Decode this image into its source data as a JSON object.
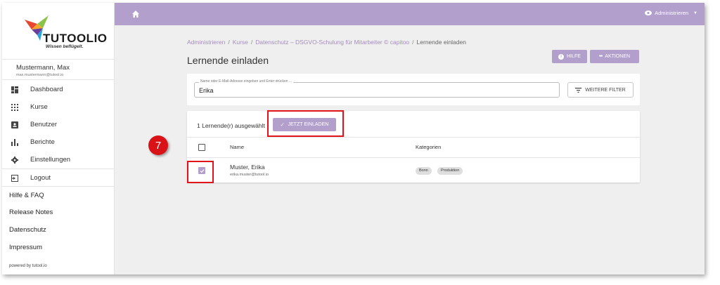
{
  "brand": {
    "name": "TUTOOLIO",
    "tagline": "Wissen beflügelt."
  },
  "user": {
    "name": "Mustermann, Max",
    "email": "max.mustermann@tutool.io"
  },
  "nav": [
    {
      "label": "Dashboard",
      "icon": "dashboard-icon"
    },
    {
      "label": "Kurse",
      "icon": "grid-icon"
    },
    {
      "label": "Benutzer",
      "icon": "user-card-icon"
    },
    {
      "label": "Berichte",
      "icon": "bar-chart-icon"
    },
    {
      "label": "Einstellungen",
      "icon": "gear-icon"
    },
    {
      "label": "Logout",
      "icon": "logout-icon"
    }
  ],
  "links": [
    "Hilfe & FAQ",
    "Release Notes",
    "Datenschutz",
    "Impressum"
  ],
  "powered": "powered by tutool.io",
  "topbar": {
    "admin_label": "Administrieren"
  },
  "breadcrumb": {
    "items": [
      "Administrieren",
      "Kurse",
      "Datenschutz – DSGVO-Schulung für Mitarbeiter © capitoo"
    ],
    "current": "Lernende einladen"
  },
  "page": {
    "title": "Lernende einladen"
  },
  "actions": {
    "help": "HILFE",
    "more": "AKTIONEN"
  },
  "search": {
    "label": "Name oder E-Mail-Adresse eingeben und Enter drücken ...",
    "value": "Erika",
    "filter_button": "WEITERE FILTER"
  },
  "table": {
    "selected_text": "1 Lernende(r) ausgewählt",
    "invite_button": "JETZT EINLADEN",
    "columns": [
      "Name",
      "Kategorien"
    ],
    "rows": [
      {
        "name": "Muster, Erika",
        "email": "erika.muster@tutool.io",
        "categories": [
          "Bonn",
          "Produktion"
        ],
        "checked": true
      }
    ]
  },
  "step": "7",
  "colors": {
    "accent": "#b39fcc",
    "highlight": "#e0141a",
    "badge": "#d81216"
  }
}
